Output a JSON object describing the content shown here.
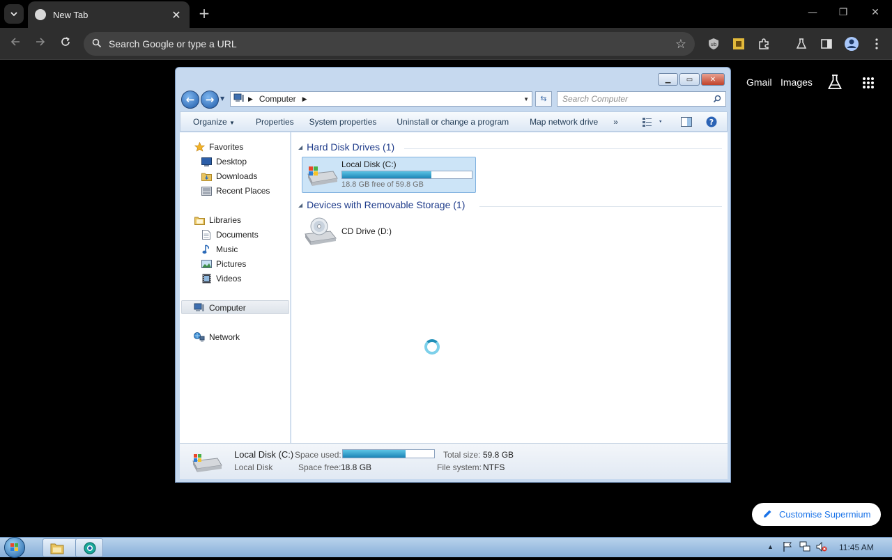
{
  "browser": {
    "tab_title": "New Tab",
    "new_tab_glyph": "+",
    "omnibox_placeholder": "Search Google or type a URL",
    "ntp": {
      "gmail": "Gmail",
      "images": "Images"
    },
    "customise_label": "Customise Supermium"
  },
  "explorer": {
    "breadcrumb": "Computer",
    "search_placeholder": "Search Computer",
    "commands": [
      "Organize",
      "Properties",
      "System properties",
      "Uninstall or change a program",
      "Map network drive"
    ],
    "overflow": "»",
    "nav": {
      "favorites": "Favorites",
      "desktop": "Desktop",
      "downloads": "Downloads",
      "recent": "Recent Places",
      "libraries": "Libraries",
      "documents": "Documents",
      "music": "Music",
      "pictures": "Pictures",
      "videos": "Videos",
      "computer": "Computer",
      "network": "Network"
    },
    "groups": {
      "hdd": "Hard Disk Drives (1)",
      "removable": "Devices with Removable Storage (1)"
    },
    "drive_c": {
      "label": "Local Disk (C:)",
      "free_text": "18.8 GB free of 59.8 GB",
      "used_fraction": 0.686
    },
    "drive_d": {
      "label": "CD Drive (D:)"
    },
    "details": {
      "name": "Local Disk (C:)",
      "type": "Local Disk",
      "space_used_label": "Space used:",
      "space_free_label": "Space free:",
      "space_free_value": "18.8 GB",
      "total_size_label": "Total size:",
      "total_size_value": "59.8 GB",
      "file_system_label": "File system:",
      "file_system_value": "NTFS"
    }
  },
  "taskbar": {
    "time": "11:45 AM"
  },
  "colors": {
    "accent_blue": "#1e3b8a",
    "chrome_dark": "#2e2e2e"
  }
}
